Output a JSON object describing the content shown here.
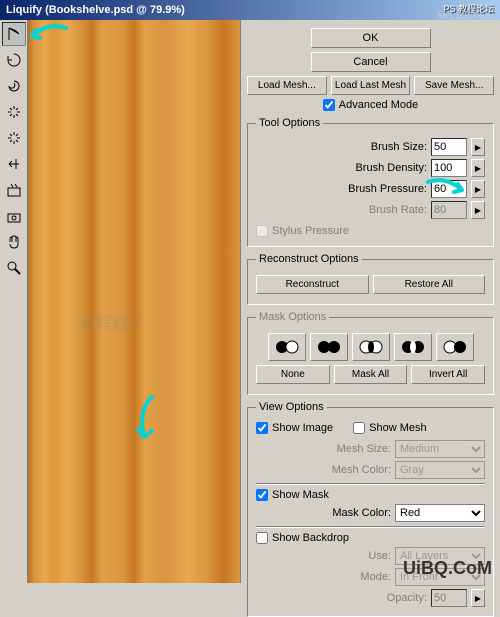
{
  "title": "Liquify (Bookshelve.psd @ 79.9%)",
  "buttons": {
    "ok": "OK",
    "cancel": "Cancel",
    "loadMesh": "Load Mesh...",
    "loadLastMesh": "Load Last Mesh",
    "saveMesh": "Save Mesh...",
    "reconstruct": "Reconstruct",
    "restoreAll": "Restore All",
    "none": "None",
    "maskAll": "Mask All",
    "invertAll": "Invert All"
  },
  "advancedMode": {
    "label": "Advanced Mode",
    "checked": true
  },
  "toolOptions": {
    "legend": "Tool Options",
    "brushSize": {
      "label": "Brush Size:",
      "value": "50"
    },
    "brushDensity": {
      "label": "Brush Density:",
      "value": "100"
    },
    "brushPressure": {
      "label": "Brush Pressure:",
      "value": "60"
    },
    "brushRate": {
      "label": "Brush Rate:",
      "value": "80"
    },
    "stylusPressure": {
      "label": "Stylus Pressure",
      "checked": false
    }
  },
  "reconstructOptions": {
    "legend": "Reconstruct Options"
  },
  "maskOptions": {
    "legend": "Mask Options"
  },
  "viewOptions": {
    "legend": "View Options",
    "showImage": {
      "label": "Show Image",
      "checked": true
    },
    "showMesh": {
      "label": "Show Mesh",
      "checked": false
    },
    "meshSize": {
      "label": "Mesh Size:",
      "value": "Medium"
    },
    "meshColor": {
      "label": "Mesh Color:",
      "value": "Gray"
    },
    "showMask": {
      "label": "Show Mask",
      "checked": true
    },
    "maskColor": {
      "label": "Mask Color:",
      "value": "Red"
    },
    "showBackdrop": {
      "label": "Show Backdrop",
      "checked": false
    },
    "use": {
      "label": "Use:",
      "value": "All Layers"
    },
    "mode": {
      "label": "Mode:",
      "value": "In Front"
    },
    "opacity": {
      "label": "Opacity:",
      "value": "50"
    }
  },
  "watermarks": {
    "top1": "PS 教程论坛",
    "top2": "BBS.16xx8.com",
    "mid": "教程盒子",
    "bottom": "UiBQ.CoM"
  }
}
